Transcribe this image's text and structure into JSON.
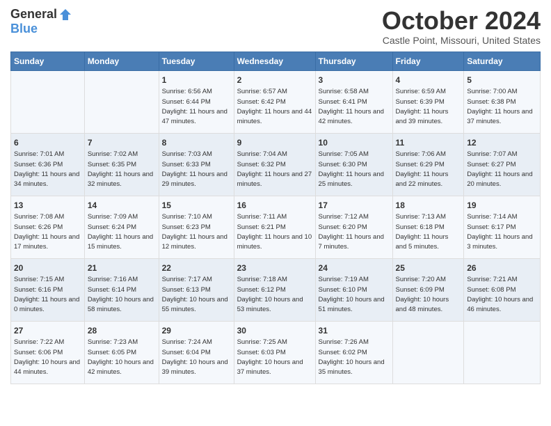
{
  "header": {
    "logo_general": "General",
    "logo_blue": "Blue",
    "month_title": "October 2024",
    "location": "Castle Point, Missouri, United States"
  },
  "days_of_week": [
    "Sunday",
    "Monday",
    "Tuesday",
    "Wednesday",
    "Thursday",
    "Friday",
    "Saturday"
  ],
  "weeks": [
    [
      {
        "day": "",
        "info": ""
      },
      {
        "day": "",
        "info": ""
      },
      {
        "day": "1",
        "info": "Sunrise: 6:56 AM\nSunset: 6:44 PM\nDaylight: 11 hours and 47 minutes."
      },
      {
        "day": "2",
        "info": "Sunrise: 6:57 AM\nSunset: 6:42 PM\nDaylight: 11 hours and 44 minutes."
      },
      {
        "day": "3",
        "info": "Sunrise: 6:58 AM\nSunset: 6:41 PM\nDaylight: 11 hours and 42 minutes."
      },
      {
        "day": "4",
        "info": "Sunrise: 6:59 AM\nSunset: 6:39 PM\nDaylight: 11 hours and 39 minutes."
      },
      {
        "day": "5",
        "info": "Sunrise: 7:00 AM\nSunset: 6:38 PM\nDaylight: 11 hours and 37 minutes."
      }
    ],
    [
      {
        "day": "6",
        "info": "Sunrise: 7:01 AM\nSunset: 6:36 PM\nDaylight: 11 hours and 34 minutes."
      },
      {
        "day": "7",
        "info": "Sunrise: 7:02 AM\nSunset: 6:35 PM\nDaylight: 11 hours and 32 minutes."
      },
      {
        "day": "8",
        "info": "Sunrise: 7:03 AM\nSunset: 6:33 PM\nDaylight: 11 hours and 29 minutes."
      },
      {
        "day": "9",
        "info": "Sunrise: 7:04 AM\nSunset: 6:32 PM\nDaylight: 11 hours and 27 minutes."
      },
      {
        "day": "10",
        "info": "Sunrise: 7:05 AM\nSunset: 6:30 PM\nDaylight: 11 hours and 25 minutes."
      },
      {
        "day": "11",
        "info": "Sunrise: 7:06 AM\nSunset: 6:29 PM\nDaylight: 11 hours and 22 minutes."
      },
      {
        "day": "12",
        "info": "Sunrise: 7:07 AM\nSunset: 6:27 PM\nDaylight: 11 hours and 20 minutes."
      }
    ],
    [
      {
        "day": "13",
        "info": "Sunrise: 7:08 AM\nSunset: 6:26 PM\nDaylight: 11 hours and 17 minutes."
      },
      {
        "day": "14",
        "info": "Sunrise: 7:09 AM\nSunset: 6:24 PM\nDaylight: 11 hours and 15 minutes."
      },
      {
        "day": "15",
        "info": "Sunrise: 7:10 AM\nSunset: 6:23 PM\nDaylight: 11 hours and 12 minutes."
      },
      {
        "day": "16",
        "info": "Sunrise: 7:11 AM\nSunset: 6:21 PM\nDaylight: 11 hours and 10 minutes."
      },
      {
        "day": "17",
        "info": "Sunrise: 7:12 AM\nSunset: 6:20 PM\nDaylight: 11 hours and 7 minutes."
      },
      {
        "day": "18",
        "info": "Sunrise: 7:13 AM\nSunset: 6:18 PM\nDaylight: 11 hours and 5 minutes."
      },
      {
        "day": "19",
        "info": "Sunrise: 7:14 AM\nSunset: 6:17 PM\nDaylight: 11 hours and 3 minutes."
      }
    ],
    [
      {
        "day": "20",
        "info": "Sunrise: 7:15 AM\nSunset: 6:16 PM\nDaylight: 11 hours and 0 minutes."
      },
      {
        "day": "21",
        "info": "Sunrise: 7:16 AM\nSunset: 6:14 PM\nDaylight: 10 hours and 58 minutes."
      },
      {
        "day": "22",
        "info": "Sunrise: 7:17 AM\nSunset: 6:13 PM\nDaylight: 10 hours and 55 minutes."
      },
      {
        "day": "23",
        "info": "Sunrise: 7:18 AM\nSunset: 6:12 PM\nDaylight: 10 hours and 53 minutes."
      },
      {
        "day": "24",
        "info": "Sunrise: 7:19 AM\nSunset: 6:10 PM\nDaylight: 10 hours and 51 minutes."
      },
      {
        "day": "25",
        "info": "Sunrise: 7:20 AM\nSunset: 6:09 PM\nDaylight: 10 hours and 48 minutes."
      },
      {
        "day": "26",
        "info": "Sunrise: 7:21 AM\nSunset: 6:08 PM\nDaylight: 10 hours and 46 minutes."
      }
    ],
    [
      {
        "day": "27",
        "info": "Sunrise: 7:22 AM\nSunset: 6:06 PM\nDaylight: 10 hours and 44 minutes."
      },
      {
        "day": "28",
        "info": "Sunrise: 7:23 AM\nSunset: 6:05 PM\nDaylight: 10 hours and 42 minutes."
      },
      {
        "day": "29",
        "info": "Sunrise: 7:24 AM\nSunset: 6:04 PM\nDaylight: 10 hours and 39 minutes."
      },
      {
        "day": "30",
        "info": "Sunrise: 7:25 AM\nSunset: 6:03 PM\nDaylight: 10 hours and 37 minutes."
      },
      {
        "day": "31",
        "info": "Sunrise: 7:26 AM\nSunset: 6:02 PM\nDaylight: 10 hours and 35 minutes."
      },
      {
        "day": "",
        "info": ""
      },
      {
        "day": "",
        "info": ""
      }
    ]
  ]
}
